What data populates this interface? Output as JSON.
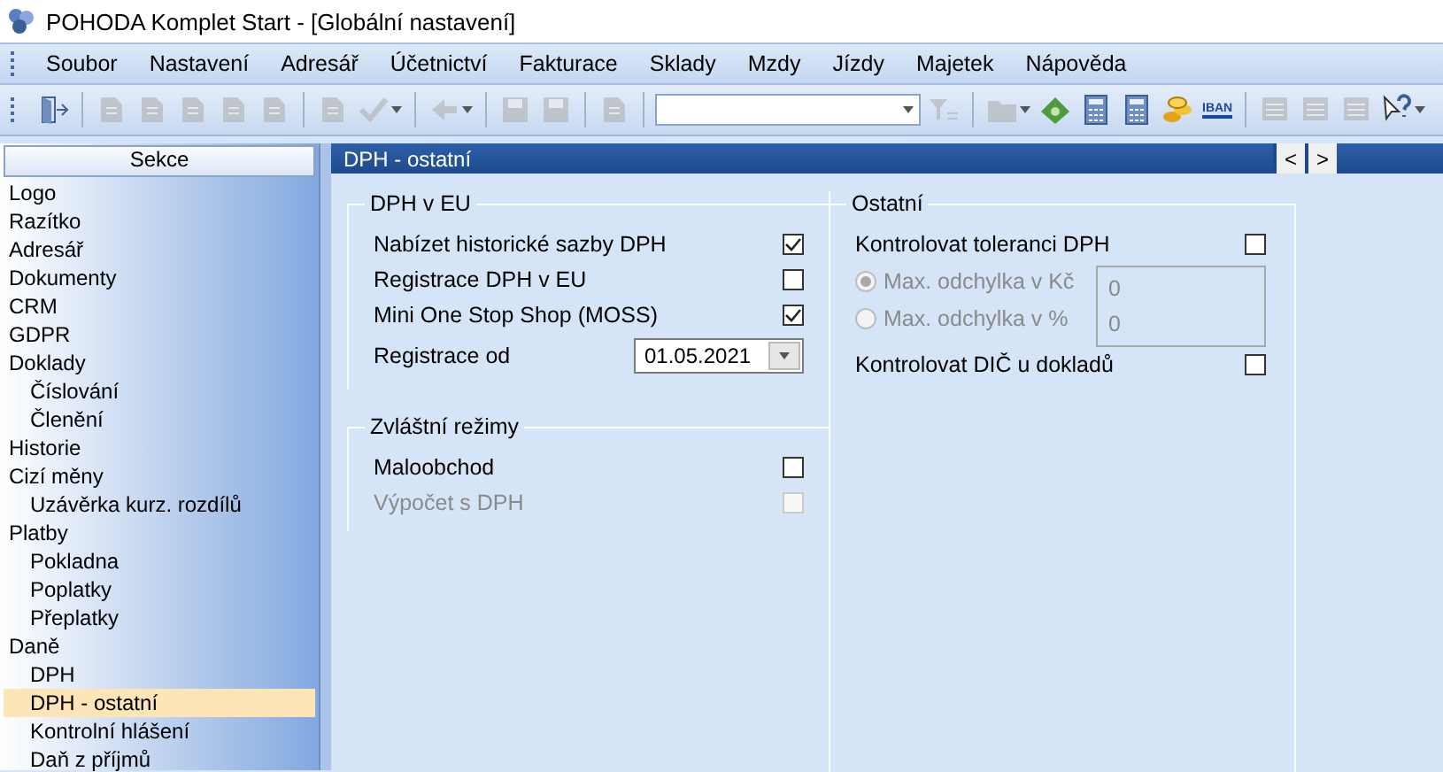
{
  "window": {
    "title": "POHODA Komplet Start - [Globální nastavení]"
  },
  "menu": [
    {
      "label": "Soubor"
    },
    {
      "label": "Nastavení"
    },
    {
      "label": "Adresář"
    },
    {
      "label": "Účetnictví"
    },
    {
      "label": "Fakturace"
    },
    {
      "label": "Sklady"
    },
    {
      "label": "Mzdy"
    },
    {
      "label": "Jízdy"
    },
    {
      "label": "Majetek"
    },
    {
      "label": "Nápověda"
    }
  ],
  "toolbar": [
    {
      "kind": "door",
      "disabled": false
    },
    {
      "kind": "sep"
    },
    {
      "kind": "doc",
      "disabled": true
    },
    {
      "kind": "doc",
      "disabled": true
    },
    {
      "kind": "doc",
      "disabled": true
    },
    {
      "kind": "doc",
      "disabled": true
    },
    {
      "kind": "doc",
      "disabled": true
    },
    {
      "kind": "sep"
    },
    {
      "kind": "doc",
      "disabled": true
    },
    {
      "kind": "check",
      "disabled": true,
      "caret": true
    },
    {
      "kind": "sep"
    },
    {
      "kind": "arrow",
      "disabled": true,
      "caret": true
    },
    {
      "kind": "sep"
    },
    {
      "kind": "save",
      "disabled": true
    },
    {
      "kind": "save",
      "disabled": true
    },
    {
      "kind": "sep"
    },
    {
      "kind": "doc",
      "disabled": true
    },
    {
      "kind": "sep"
    },
    {
      "kind": "combo"
    },
    {
      "kind": "filter",
      "disabled": true
    },
    {
      "kind": "sep"
    },
    {
      "kind": "folder",
      "disabled": true,
      "caret": true
    },
    {
      "kind": "money",
      "disabled": false
    },
    {
      "kind": "calc",
      "disabled": false
    },
    {
      "kind": "calc",
      "disabled": false
    },
    {
      "kind": "coins",
      "disabled": false
    },
    {
      "kind": "text",
      "label": "IBAN",
      "disabled": false
    },
    {
      "kind": "sep"
    },
    {
      "kind": "list",
      "disabled": true
    },
    {
      "kind": "list",
      "disabled": true
    },
    {
      "kind": "list",
      "disabled": true
    },
    {
      "kind": "help",
      "disabled": false,
      "caret": true
    }
  ],
  "sidebar": {
    "header": "Sekce",
    "items": [
      {
        "label": "Logo",
        "selected": false
      },
      {
        "label": "Razítko",
        "selected": false
      },
      {
        "label": "Adresář",
        "selected": false
      },
      {
        "label": "Dokumenty",
        "selected": false
      },
      {
        "label": "CRM",
        "selected": false
      },
      {
        "label": "GDPR",
        "selected": false
      },
      {
        "label": "Doklady",
        "selected": false,
        "children": [
          {
            "label": "Číslování",
            "selected": false
          },
          {
            "label": "Členění",
            "selected": false
          }
        ]
      },
      {
        "label": "Historie",
        "selected": false
      },
      {
        "label": "Cizí měny",
        "selected": false,
        "children": [
          {
            "label": "Uzávěrka kurz. rozdílů",
            "selected": false
          }
        ]
      },
      {
        "label": "Platby",
        "selected": false,
        "children": [
          {
            "label": "Pokladna",
            "selected": false
          },
          {
            "label": "Poplatky",
            "selected": false
          },
          {
            "label": "Přeplatky",
            "selected": false
          }
        ]
      },
      {
        "label": "Daně",
        "selected": false,
        "children": [
          {
            "label": "DPH",
            "selected": false
          },
          {
            "label": "DPH - ostatní",
            "selected": true
          },
          {
            "label": "Kontrolní hlášení",
            "selected": false
          },
          {
            "label": "Daň z příjmů",
            "selected": false
          }
        ]
      }
    ]
  },
  "panel": {
    "title": "DPH - ostatní",
    "nav": [
      "<",
      ">"
    ],
    "left": [
      {
        "legend": "DPH v EU",
        "rows": [
          {
            "kind": "check",
            "label": "Nabízet historické sazby DPH",
            "checked": true,
            "disabled": false
          },
          {
            "kind": "check",
            "label": "Registrace DPH v EU",
            "checked": false,
            "disabled": false
          },
          {
            "kind": "check",
            "label": "Mini One Stop Shop (MOSS)",
            "checked": true,
            "disabled": false
          },
          {
            "kind": "date",
            "label": "Registrace od",
            "value": "01.05.2021"
          }
        ]
      },
      {
        "legend": "Zvláštní režimy",
        "rows": [
          {
            "kind": "check",
            "label": "Maloobchod",
            "checked": false,
            "disabled": false
          },
          {
            "kind": "check",
            "label": "Výpočet s DPH",
            "checked": false,
            "disabled": true
          }
        ]
      }
    ],
    "right": {
      "legend": "Ostatní",
      "rows": [
        {
          "kind": "check",
          "label": "Kontrolovat toleranci DPH",
          "checked": false,
          "disabled": false
        },
        {
          "kind": "radios",
          "disabled": true,
          "options": [
            {
              "label": "Max. odchylka v Kč",
              "value": "0",
              "selected": true
            },
            {
              "label": "Max. odchylka v %",
              "value": "0",
              "selected": false
            }
          ]
        },
        {
          "kind": "check",
          "label": "Kontrolovat DIČ u dokladů",
          "checked": false,
          "disabled": false
        }
      ]
    }
  }
}
